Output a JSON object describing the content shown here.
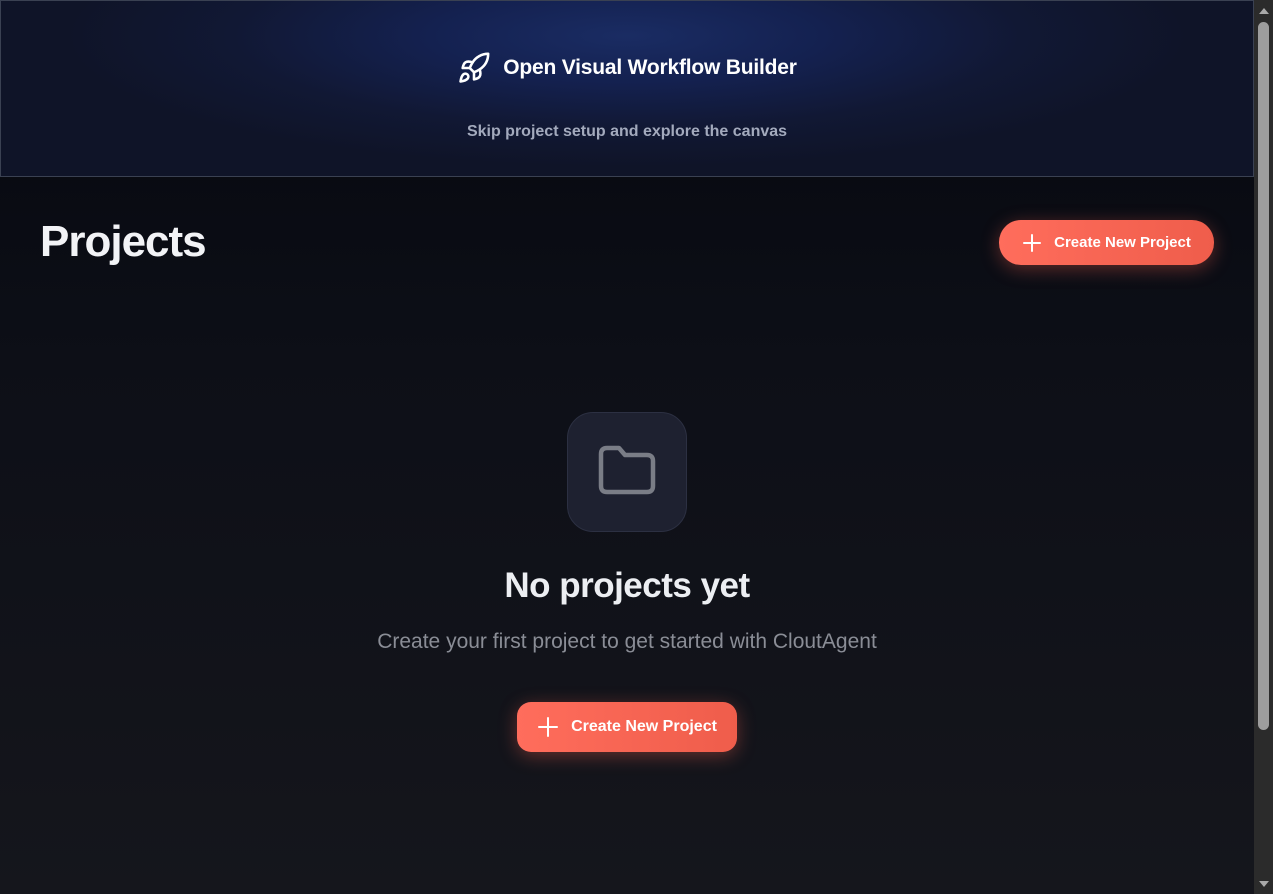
{
  "banner": {
    "title": "Open Visual Workflow Builder",
    "subtitle": "Skip project setup and explore the canvas",
    "icon": "rocket-icon"
  },
  "header": {
    "title": "Projects",
    "create_button_label": "Create New Project",
    "create_button_icon": "plus-icon"
  },
  "empty_state": {
    "icon": "folder-icon",
    "title": "No projects yet",
    "subtitle": "Create your first project to get started with CloutAgent",
    "button_label": "Create New Project",
    "button_icon": "plus-icon"
  },
  "colors": {
    "accent": "#ff6d5c",
    "background": "#0d0f17",
    "banner_background": "#142150"
  }
}
